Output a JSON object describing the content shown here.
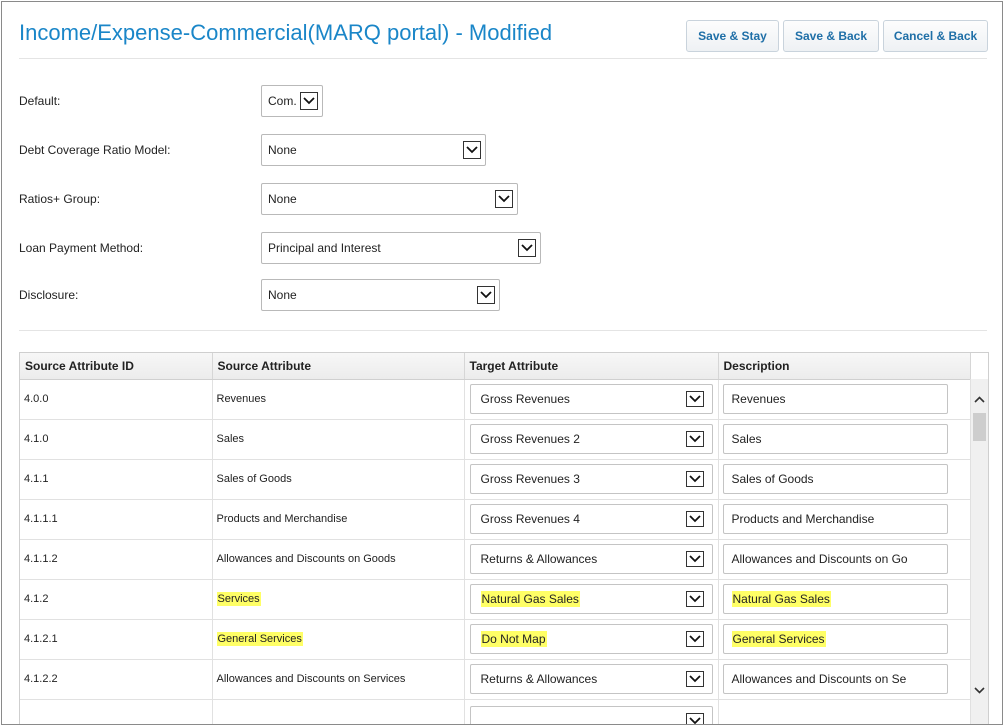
{
  "header": {
    "title": "Income/Expense-Commercial(MARQ portal) - Modified",
    "save_stay_label": "Save & Stay",
    "save_back_label": "Save & Back",
    "cancel_back_label": "Cancel & Back"
  },
  "form": {
    "default": {
      "label": "Default:",
      "value": "Com."
    },
    "dcr_model": {
      "label": "Debt Coverage Ratio Model:",
      "value": "None"
    },
    "ratios_group": {
      "label": "Ratios+ Group:",
      "value": "None"
    },
    "loan_payment": {
      "label": "Loan Payment Method:",
      "value": "Principal and Interest"
    },
    "disclosure": {
      "label": "Disclosure:",
      "value": "None"
    }
  },
  "table": {
    "columns": [
      "Source Attribute ID",
      "Source Attribute",
      "Target Attribute",
      "Description"
    ],
    "rows": [
      {
        "id": "4.0.0",
        "source": "Revenues",
        "target": "Gross Revenues",
        "description": "Revenues",
        "highlight": false
      },
      {
        "id": "4.1.0",
        "source": "Sales",
        "target": "Gross Revenues 2",
        "description": "Sales",
        "highlight": false
      },
      {
        "id": "4.1.1",
        "source": "Sales of Goods",
        "target": "Gross Revenues 3",
        "description": "Sales of Goods",
        "highlight": false
      },
      {
        "id": "4.1.1.1",
        "source": "Products and Merchandise",
        "target": "Gross Revenues 4",
        "description": "Products and Merchandise",
        "highlight": false
      },
      {
        "id": "4.1.1.2",
        "source": "Allowances and Discounts on Goods",
        "target": "Returns & Allowances",
        "description": "Allowances and Discounts on Go",
        "highlight": false
      },
      {
        "id": "4.1.2",
        "source": "Services",
        "target": "Natural Gas Sales",
        "description": "Natural Gas Sales",
        "highlight": true
      },
      {
        "id": "4.1.2.1",
        "source": "General Services",
        "target": "Do Not Map",
        "description": "General Services",
        "highlight": true
      },
      {
        "id": "4.1.2.2",
        "source": "Allowances and Discounts on Services",
        "target": "Returns & Allowances",
        "description": "Allowances and Discounts on Se",
        "highlight": false
      }
    ]
  },
  "colors": {
    "title": "#1a86c8",
    "button_text": "#1f6fa7",
    "highlight": "#ffff66"
  },
  "icons": {
    "dropdown": "chevron-down-icon",
    "scroll_up": "chevron-up-icon",
    "scroll_down": "chevron-down-icon"
  }
}
